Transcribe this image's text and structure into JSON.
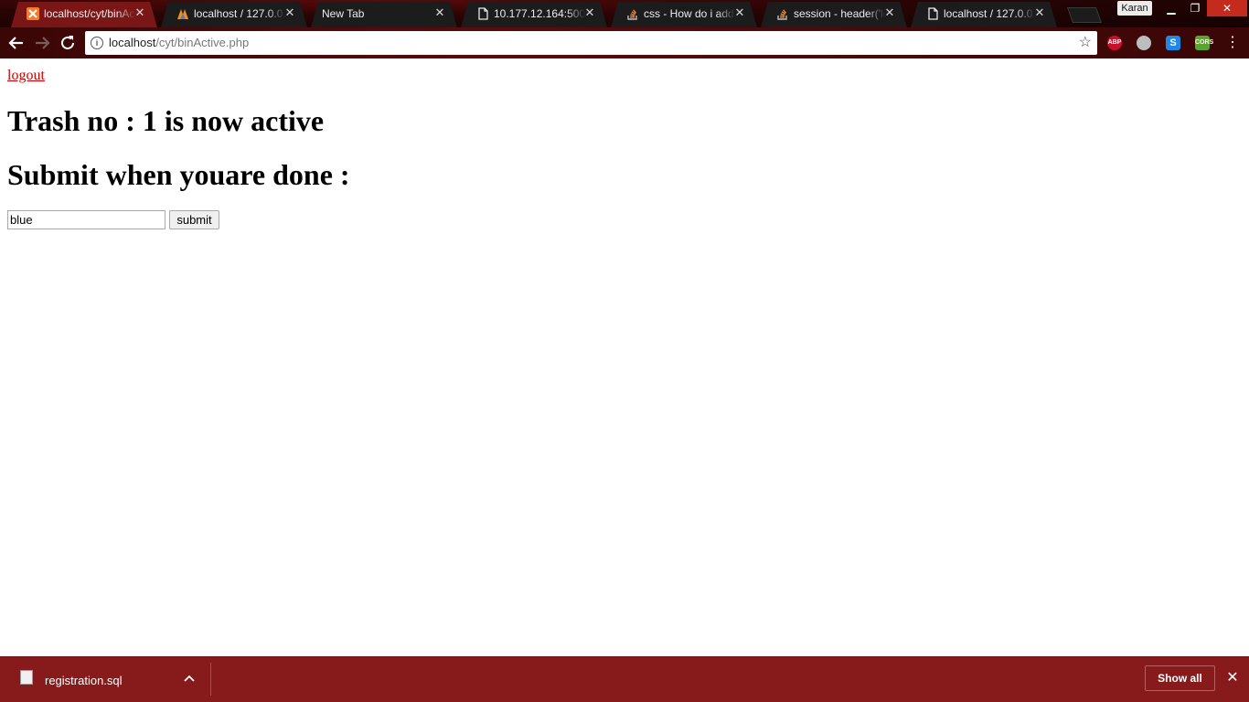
{
  "browser": {
    "tabs": [
      {
        "title": "localhost/cyt/binActive.php",
        "icon": "xampp-icon",
        "active": true
      },
      {
        "title": "localhost / 127.0.0.1",
        "icon": "phpmyadmin-icon",
        "active": false
      },
      {
        "title": "New Tab",
        "icon": "",
        "active": false
      },
      {
        "title": "10.177.12.164:5000",
        "icon": "page-icon",
        "active": false
      },
      {
        "title": "css - How do i add",
        "icon": "stackoverflow-icon",
        "active": false
      },
      {
        "title": "session - header('lo",
        "icon": "stackoverflow-icon",
        "active": false
      },
      {
        "title": "localhost / 127.0.0.1",
        "icon": "page-icon",
        "active": false
      }
    ],
    "profile_name": "Karan",
    "address": {
      "host": "localhost",
      "path": "/cyt/binActive.php"
    },
    "extensions": [
      "ABP",
      "",
      "S",
      "CORS"
    ],
    "colors": {
      "accent": "#7a1616",
      "download_bar": "#871a1a",
      "link": "#cc0000"
    }
  },
  "page": {
    "logout_label": "logout",
    "heading_active": "Trash no : 1 is now active",
    "heading_submit": "Submit when youare done :",
    "input_value": "blue",
    "submit_label": "submit"
  },
  "downloads": {
    "file_name": "registration.sql",
    "show_all_label": "Show all"
  }
}
